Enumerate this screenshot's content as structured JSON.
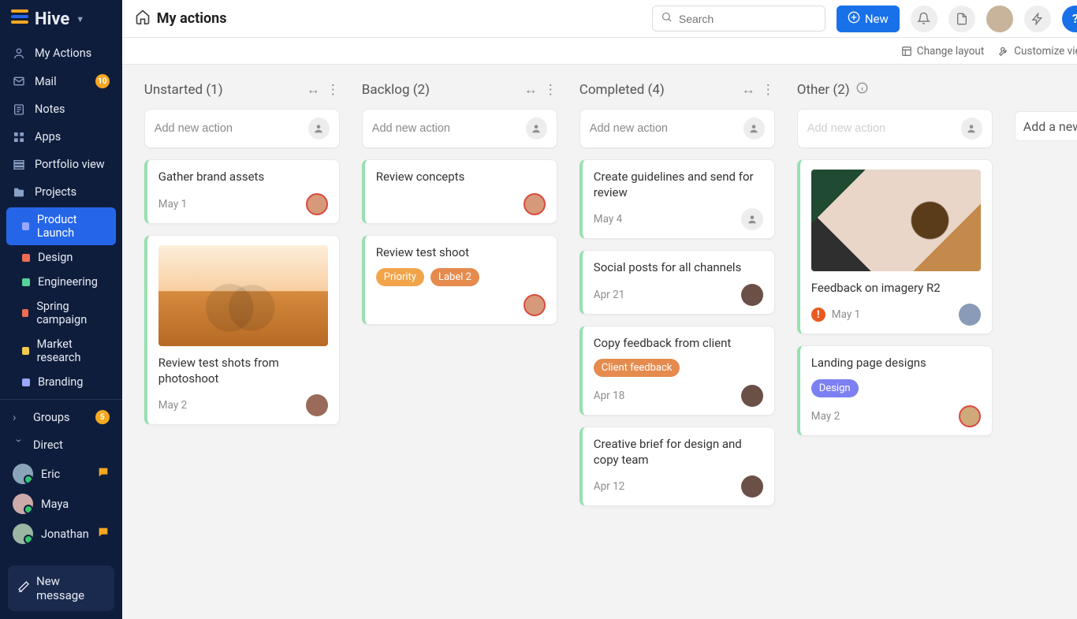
{
  "brand": "Hive",
  "header": {
    "title": "My actions",
    "search_placeholder": "Search",
    "new_button": "New",
    "controls": {
      "change_layout": "Change layout",
      "customize": "Customize view"
    }
  },
  "sidebar": {
    "items": [
      {
        "label": "My Actions"
      },
      {
        "label": "Mail",
        "badge": "10"
      },
      {
        "label": "Notes"
      },
      {
        "label": "Apps"
      },
      {
        "label": "Portfolio view"
      },
      {
        "label": "Projects"
      }
    ],
    "projects": [
      {
        "label": "Product Launch",
        "color": "#9aa7ff",
        "active": true
      },
      {
        "label": "Design",
        "color": "#ef6b52"
      },
      {
        "label": "Engineering",
        "color": "#56d398"
      },
      {
        "label": "Spring campaign",
        "color": "#ef6b52"
      },
      {
        "label": "Market research",
        "color": "#f2c94c"
      },
      {
        "label": "Branding",
        "color": "#9aa7ff"
      }
    ],
    "groups_label": "Groups",
    "groups_badge": "5",
    "direct_label": "Direct",
    "dms": [
      {
        "name": "Eric",
        "unread": true,
        "bg": "#8aa5b8"
      },
      {
        "name": "Maya",
        "unread": false,
        "bg": "#caa"
      },
      {
        "name": "Jonathan",
        "unread": true,
        "bg": "#9bb6a2"
      }
    ],
    "new_message": "New message"
  },
  "board": {
    "add_new_placeholder": "Add new action",
    "add_column_label": "Add a new",
    "columns": [
      {
        "title": "Unstarted (1)",
        "cards": [
          {
            "title": "Gather brand assets",
            "date": "May 1",
            "avatar": "#d69a7a",
            "ring": true
          },
          {
            "image": "sunglasses",
            "title": "Review test shots from photoshoot",
            "date": "May 2",
            "avatar": "#9a6b5a"
          }
        ]
      },
      {
        "title": "Backlog (2)",
        "cards": [
          {
            "title": "Review concepts",
            "date": "",
            "avatar": "#d69a7a",
            "ring": true
          },
          {
            "title": "Review test shoot",
            "tags": [
              {
                "text": "Priority",
                "cls": "orange"
              },
              {
                "text": "Label 2",
                "cls": "lorange"
              }
            ],
            "avatar": "#d69a7a",
            "ring": true
          }
        ]
      },
      {
        "title": "Completed (4)",
        "cards": [
          {
            "title": "Create guidelines and send for review",
            "date": "May 4",
            "ph": true
          },
          {
            "title": "Social posts for all channels",
            "date": "Apr 21",
            "avatar": "#6b5048"
          },
          {
            "title": "Copy feedback from client",
            "tags": [
              {
                "text": "Client feedback",
                "cls": "lorange"
              }
            ],
            "date": "Apr 18",
            "avatar": "#6b5048"
          },
          {
            "title": "Creative brief for design and copy team",
            "date": "Apr 12",
            "avatar": "#6b5048"
          }
        ]
      },
      {
        "title": "Other (2)",
        "info": true,
        "disabled": true,
        "cards": [
          {
            "image": "flatlay",
            "title": "Feedback on imagery R2",
            "alert": true,
            "date": "May 1",
            "avatar": "#8a9bb8"
          },
          {
            "title": "Landing page designs",
            "tags": [
              {
                "text": "Design",
                "cls": "blue"
              }
            ],
            "date": "May 2",
            "avatar": "#cfa97a",
            "ring": true
          }
        ]
      }
    ]
  }
}
